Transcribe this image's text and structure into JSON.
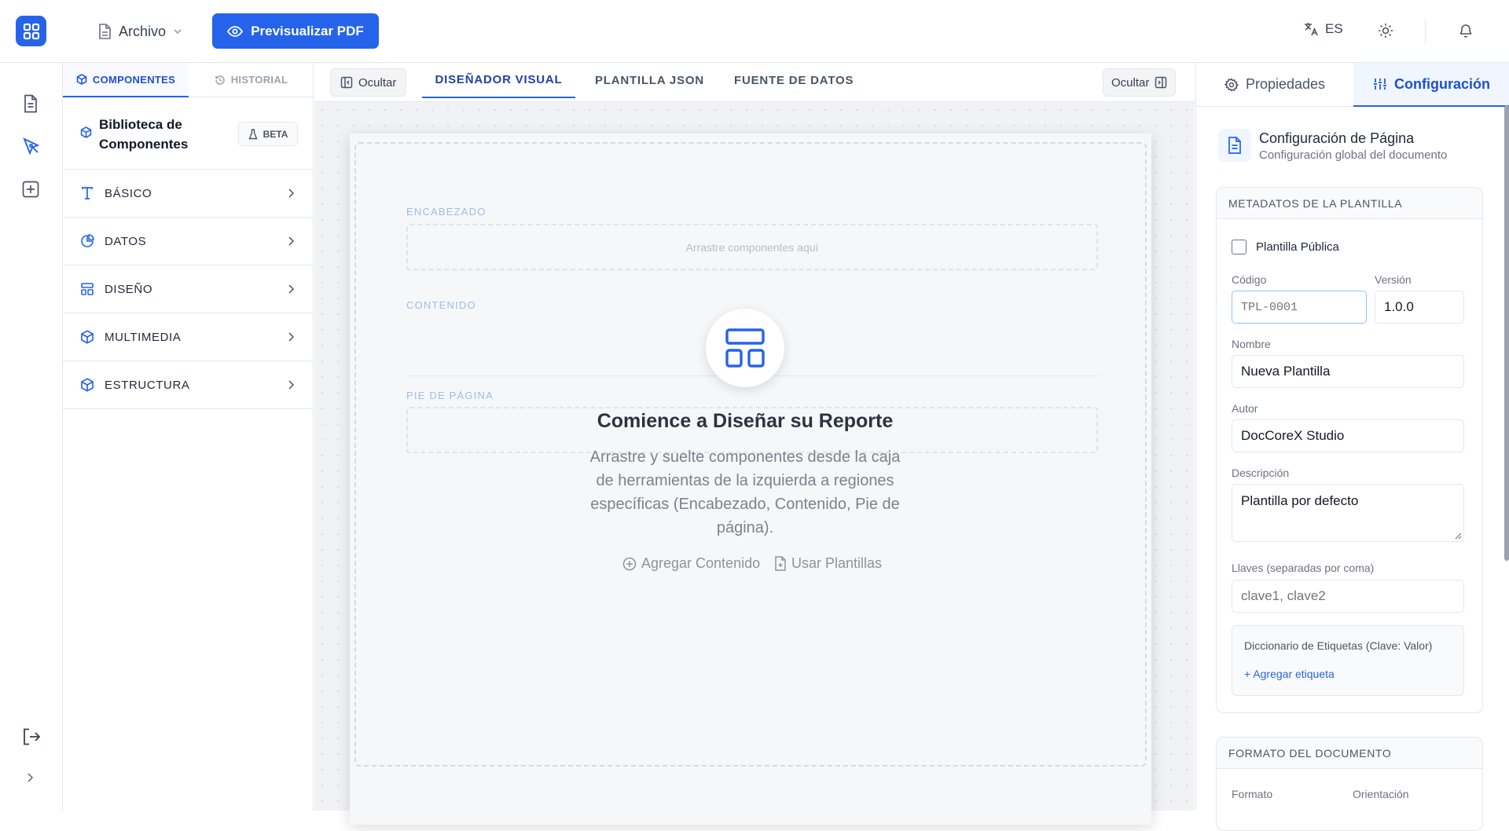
{
  "header": {
    "file_menu": "Archivo",
    "preview_button": "Previsualizar PDF",
    "language": "ES"
  },
  "left_panel": {
    "tabs": [
      "COMPONENTES",
      "HISTORIAL"
    ],
    "library_title": "Biblioteca de Componentes",
    "badge": "BETA",
    "categories": [
      {
        "label": "BÁSICO",
        "icon": "text-type-icon"
      },
      {
        "label": "DATOS",
        "icon": "pie-chart-icon"
      },
      {
        "label": "DISEÑO",
        "icon": "layout-icon"
      },
      {
        "label": "MULTIMEDIA",
        "icon": "cube-icon"
      },
      {
        "label": "ESTRUCTURA",
        "icon": "cube-icon"
      }
    ]
  },
  "canvas": {
    "hide_left": "Ocultar",
    "hide_right": "Ocultar",
    "tabs": [
      "DISEÑADOR VISUAL",
      "PLANTILLA JSON",
      "FUENTE DE DATOS"
    ],
    "regions": {
      "header": "ENCABEZADO",
      "content": "CONTENIDO",
      "footer": "PIE DE PÁGINA",
      "drop_hint": "Arrastre componentes aquí"
    },
    "empty_state": {
      "title": "Comience a Diseñar su Reporte",
      "description": "Arrastre y suelte componentes desde la caja de herramientas de la izquierda a regiones específicas (Encabezado, Contenido, Pie de página).",
      "add_content": "Agregar Contenido",
      "use_templates": "Usar Plantillas"
    }
  },
  "right_panel": {
    "tabs": [
      "Propiedades",
      "Configuración"
    ],
    "title": "Configuración de Página",
    "subtitle": "Configuración global del documento",
    "metadata": {
      "heading": "METADATOS DE LA PLANTILLA",
      "public_label": "Plantilla Pública",
      "public_checked": false,
      "code_label": "Código",
      "code_placeholder": "TPL-0001",
      "version_label": "Versión",
      "version_value": "1.0.0",
      "name_label": "Nombre",
      "name_value": "Nueva Plantilla",
      "author_label": "Autor",
      "author_value": "DocCoreX Studio",
      "description_label": "Descripción",
      "description_value": "Plantilla por defecto",
      "keys_label": "Llaves (separadas por coma)",
      "keys_placeholder": "clave1, clave2",
      "tags_label": "Diccionario de Etiquetas (Clave: Valor)",
      "add_tag": "+ Agregar etiqueta"
    },
    "format": {
      "heading": "FORMATO DEL DOCUMENTO",
      "format_label": "Formato",
      "orientation_label": "Orientación"
    }
  },
  "colors": {
    "accent": "#2563eb",
    "accent_dark": "#1d4ed8"
  }
}
